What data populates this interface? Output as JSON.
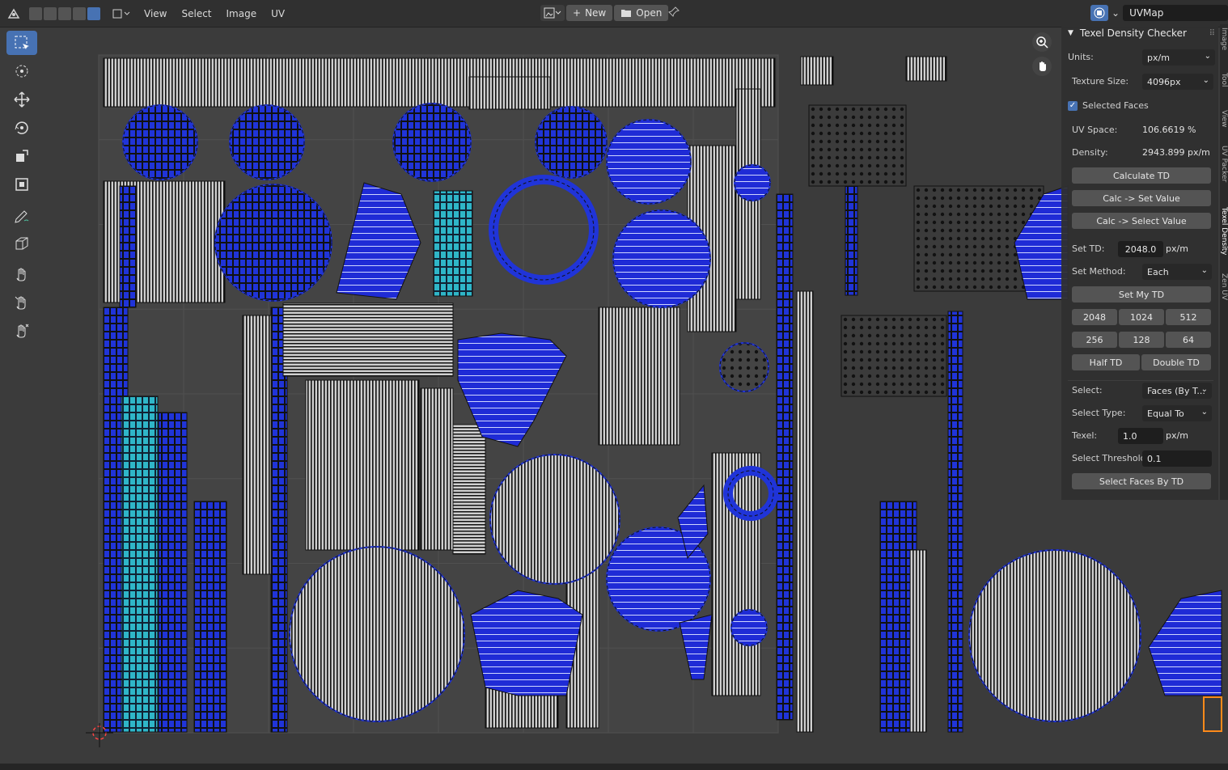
{
  "header": {
    "menu": [
      "View",
      "Select",
      "Image",
      "UV"
    ],
    "new_label": "New",
    "open_label": "Open",
    "uvmap_value": "UVMap"
  },
  "panel": {
    "title": "Texel Density Checker",
    "units_label": "Units:",
    "units_value": "px/m",
    "texture_size_label": "Texture Size:",
    "texture_size_value": "4096px",
    "selected_faces_label": "Selected Faces",
    "uv_space_label": "UV Space:",
    "uv_space_value": "106.6619 %",
    "density_label": "Density:",
    "density_value": "2943.899 px/m",
    "calculate_td": "Calculate TD",
    "calc_set_value": "Calc -> Set Value",
    "calc_select_value": "Calc -> Select Value",
    "set_td_label": "Set TD:",
    "set_td_value": "2048.0",
    "set_td_unit": "px/m",
    "set_method_label": "Set Method:",
    "set_method_value": "Each",
    "set_my_td": "Set My TD",
    "presets": [
      "2048",
      "1024",
      "512",
      "256",
      "128",
      "64"
    ],
    "half_td": "Half TD",
    "double_td": "Double TD",
    "select_label": "Select:",
    "select_value": "Faces (By T...",
    "select_type_label": "Select Type:",
    "select_type_value": "Equal To",
    "texel_label": "Texel:",
    "texel_value": "1.0",
    "texel_unit": "px/m",
    "threshold_label": "Select Threshold:",
    "threshold_value": "0.1",
    "select_faces_by_td": "Select Faces By TD"
  },
  "side_tabs": [
    "Image",
    "Tool",
    "View",
    "UV Packer",
    "Texel Density",
    "Zen UV"
  ],
  "colors": {
    "accent": "#4772b3",
    "uv_fill": "#1f2bd6",
    "uv_cyan": "#2fb6c8",
    "uv_grid": "#5a5a5a"
  }
}
